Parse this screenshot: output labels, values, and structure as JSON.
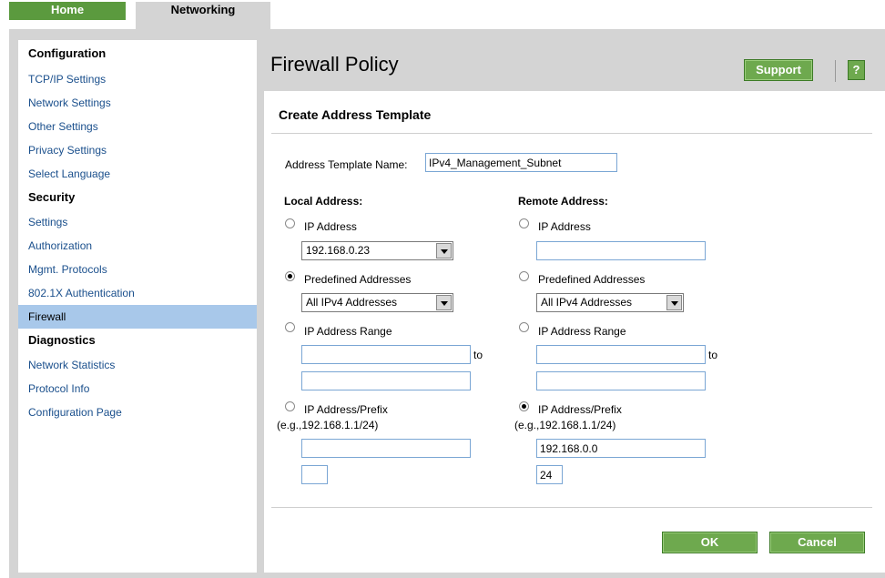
{
  "tabs": {
    "home": "Home",
    "networking": "Networking"
  },
  "sidebar": {
    "configuration_heading": "Configuration",
    "tcpip": "TCP/IP Settings",
    "network_settings": "Network Settings",
    "other_settings": "Other Settings",
    "privacy_settings": "Privacy Settings",
    "select_language": "Select Language",
    "security_heading": "Security",
    "settings": "Settings",
    "authorization": "Authorization",
    "mgmt_protocols": "Mgmt. Protocols",
    "dot1x": "802.1X Authentication",
    "firewall": "Firewall",
    "diagnostics_heading": "Diagnostics",
    "network_statistics": "Network Statistics",
    "protocol_info": "Protocol Info",
    "configuration_page": "Configuration Page"
  },
  "header": {
    "title": "Firewall Policy",
    "support": "Support",
    "help": "?"
  },
  "form": {
    "section_title": "Create Address Template",
    "template_name_label": "Address Template Name:",
    "template_name_value": "IPv4_Management_Subnet",
    "local": {
      "heading": "Local Address:",
      "ip_address_label": "IP Address",
      "ip_address_selected": "192.168.0.23",
      "predefined_label": "Predefined Addresses",
      "predefined_selected": "All IPv4 Addresses",
      "range_label": "IP Address Range",
      "range_to": "to",
      "range_start": "",
      "range_end": "",
      "prefix_label": "IP Address/Prefix",
      "prefix_example": "(e.g.,192.168.1.1/24)",
      "prefix_address": "",
      "prefix_length": "",
      "selected_option": "predefined"
    },
    "remote": {
      "heading": "Remote Address:",
      "ip_address_label": "IP Address",
      "ip_address_value": "",
      "predefined_label": "Predefined Addresses",
      "predefined_selected": "All IPv4 Addresses",
      "range_label": "IP Address Range",
      "range_to": "to",
      "range_start": "",
      "range_end": "",
      "prefix_label": "IP Address/Prefix",
      "prefix_example": "(e.g.,192.168.1.1/24)",
      "prefix_address": "192.168.0.0",
      "prefix_length": "24",
      "selected_option": "prefix"
    },
    "ok": "OK",
    "cancel": "Cancel"
  }
}
